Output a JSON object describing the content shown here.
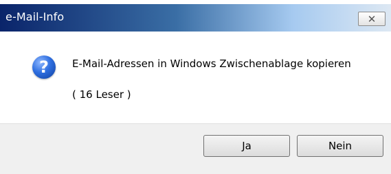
{
  "window": {
    "title": "e-Mail-Info",
    "close_glyph": "✕"
  },
  "message": {
    "icon": "question-icon",
    "icon_glyph": "?",
    "line1": "E-Mail-Adressen in Windows Zwischenablage kopieren",
    "line2": "( 16 Leser )"
  },
  "buttons": {
    "yes_label": "Ja",
    "no_label": "Nein"
  }
}
